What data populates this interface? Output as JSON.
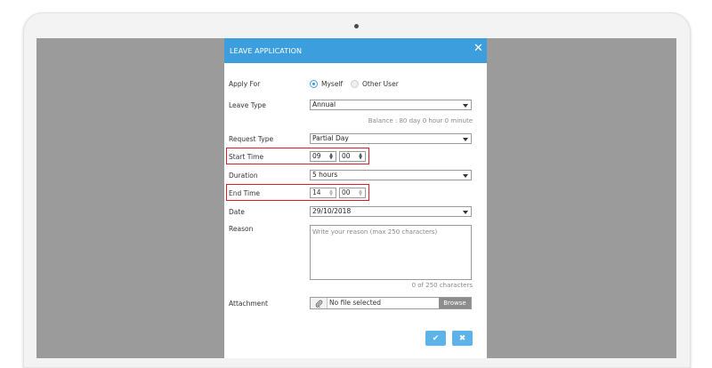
{
  "modal": {
    "title": "LEAVE APPLICATION",
    "close_icon": "close-icon"
  },
  "form": {
    "apply_for": {
      "label": "Apply For",
      "options": [
        "Myself",
        "Other User"
      ],
      "selected": "Myself"
    },
    "leave_type": {
      "label": "Leave Type",
      "value": "Annual",
      "balance": "Balance : 80 day 0 hour 0 minute"
    },
    "request_type": {
      "label": "Request Type",
      "value": "Partial Day"
    },
    "start_time": {
      "label": "Start Time",
      "hour": "09",
      "minute": "00"
    },
    "duration": {
      "label": "Duration",
      "value": "5 hours"
    },
    "end_time": {
      "label": "End Time",
      "hour": "14",
      "minute": "00"
    },
    "date": {
      "label": "Date",
      "value": "29/10/2018"
    },
    "reason": {
      "label": "Reason",
      "placeholder": "Write your reason (max 250 characters)",
      "counter": "0 of 250 characters"
    },
    "attachment": {
      "label": "Attachment",
      "file_text": "No file selected",
      "browse_label": "Browse"
    }
  },
  "actions": {
    "submit_icon": "check-icon",
    "cancel_icon": "close-icon"
  },
  "colors": {
    "header": "#3d9ede",
    "button": "#5cb3ea",
    "highlight": "#d9202a"
  }
}
